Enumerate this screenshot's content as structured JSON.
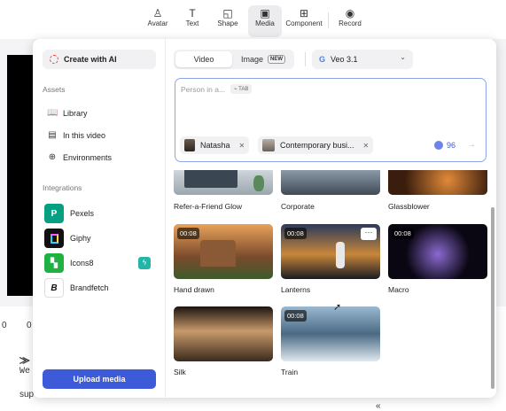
{
  "toolbar": {
    "items": [
      {
        "label": "Avatar",
        "icon": "avatar-icon"
      },
      {
        "label": "Text",
        "icon": "text-icon"
      },
      {
        "label": "Shape",
        "icon": "shape-icon"
      },
      {
        "label": "Media",
        "icon": "media-icon"
      },
      {
        "label": "Component",
        "icon": "component-icon"
      },
      {
        "label": "Record",
        "icon": "record-icon"
      }
    ],
    "active": "Media"
  },
  "background": {
    "left_num1": "0",
    "left_num2": "0",
    "text1": "We",
    "text2": "sup"
  },
  "left_panel": {
    "create_ai": "Create with AI",
    "assets_heading": "Assets",
    "assets": [
      {
        "label": "Library",
        "icon": "book-icon"
      },
      {
        "label": "In this video",
        "icon": "film-icon"
      },
      {
        "label": "Environments",
        "icon": "globe-icon"
      }
    ],
    "integrations_heading": "Integrations",
    "integrations": [
      {
        "label": "Pexels",
        "color": "#05a081"
      },
      {
        "label": "Giphy",
        "color": "#111111"
      },
      {
        "label": "Icons8",
        "color": "#1fb141"
      },
      {
        "label": "Brandfetch",
        "color": "#ffffff"
      }
    ],
    "upload": "Upload media"
  },
  "right_panel": {
    "tabs": [
      "Video",
      "Image"
    ],
    "new_badge": "NEW",
    "model": "Veo 3.1",
    "prompt_placeholder": "Person in a...",
    "tab_hint": "TAB",
    "chips": [
      "Natasha",
      "Contemporary busi..."
    ],
    "credits": "96",
    "grid": [
      {
        "caption": "Refer-a-Friend Glow",
        "duration": ""
      },
      {
        "caption": "Corporate",
        "duration": ""
      },
      {
        "caption": "Glassblower",
        "duration": ""
      },
      {
        "caption": "Hand drawn",
        "duration": "00:08"
      },
      {
        "caption": "Lanterns",
        "duration": "00:08"
      },
      {
        "caption": "Macro",
        "duration": "00:08"
      },
      {
        "caption": "Silk",
        "duration": ""
      },
      {
        "caption": "Train",
        "duration": "00:08"
      }
    ]
  },
  "colors": {
    "accent": "#3d5bd9",
    "prompt_border": "#8ea3f0"
  }
}
